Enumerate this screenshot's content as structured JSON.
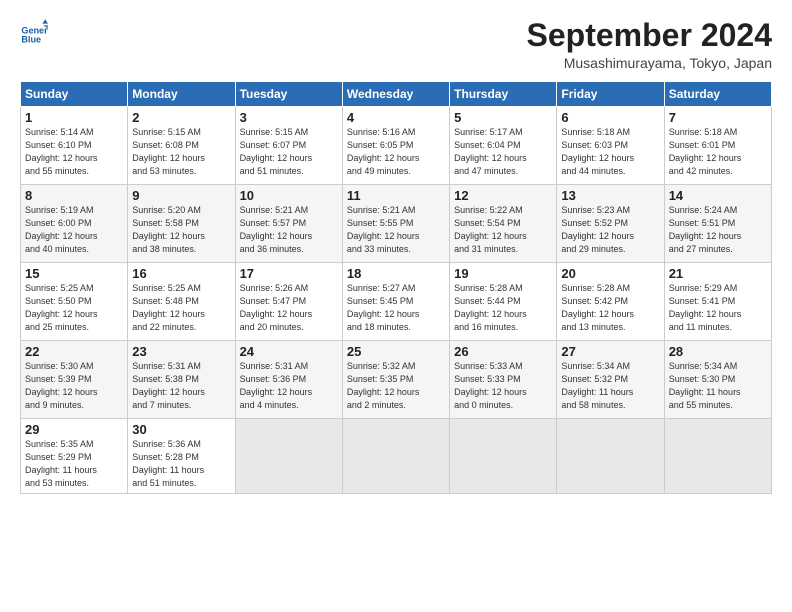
{
  "header": {
    "logo_line1": "General",
    "logo_line2": "Blue",
    "month": "September 2024",
    "location": "Musashimurayama, Tokyo, Japan"
  },
  "weekdays": [
    "Sunday",
    "Monday",
    "Tuesday",
    "Wednesday",
    "Thursday",
    "Friday",
    "Saturday"
  ],
  "weeks": [
    [
      {
        "day": "1",
        "info": "Sunrise: 5:14 AM\nSunset: 6:10 PM\nDaylight: 12 hours\nand 55 minutes."
      },
      {
        "day": "2",
        "info": "Sunrise: 5:15 AM\nSunset: 6:08 PM\nDaylight: 12 hours\nand 53 minutes."
      },
      {
        "day": "3",
        "info": "Sunrise: 5:15 AM\nSunset: 6:07 PM\nDaylight: 12 hours\nand 51 minutes."
      },
      {
        "day": "4",
        "info": "Sunrise: 5:16 AM\nSunset: 6:05 PM\nDaylight: 12 hours\nand 49 minutes."
      },
      {
        "day": "5",
        "info": "Sunrise: 5:17 AM\nSunset: 6:04 PM\nDaylight: 12 hours\nand 47 minutes."
      },
      {
        "day": "6",
        "info": "Sunrise: 5:18 AM\nSunset: 6:03 PM\nDaylight: 12 hours\nand 44 minutes."
      },
      {
        "day": "7",
        "info": "Sunrise: 5:18 AM\nSunset: 6:01 PM\nDaylight: 12 hours\nand 42 minutes."
      }
    ],
    [
      {
        "day": "8",
        "info": "Sunrise: 5:19 AM\nSunset: 6:00 PM\nDaylight: 12 hours\nand 40 minutes."
      },
      {
        "day": "9",
        "info": "Sunrise: 5:20 AM\nSunset: 5:58 PM\nDaylight: 12 hours\nand 38 minutes."
      },
      {
        "day": "10",
        "info": "Sunrise: 5:21 AM\nSunset: 5:57 PM\nDaylight: 12 hours\nand 36 minutes."
      },
      {
        "day": "11",
        "info": "Sunrise: 5:21 AM\nSunset: 5:55 PM\nDaylight: 12 hours\nand 33 minutes."
      },
      {
        "day": "12",
        "info": "Sunrise: 5:22 AM\nSunset: 5:54 PM\nDaylight: 12 hours\nand 31 minutes."
      },
      {
        "day": "13",
        "info": "Sunrise: 5:23 AM\nSunset: 5:52 PM\nDaylight: 12 hours\nand 29 minutes."
      },
      {
        "day": "14",
        "info": "Sunrise: 5:24 AM\nSunset: 5:51 PM\nDaylight: 12 hours\nand 27 minutes."
      }
    ],
    [
      {
        "day": "15",
        "info": "Sunrise: 5:25 AM\nSunset: 5:50 PM\nDaylight: 12 hours\nand 25 minutes."
      },
      {
        "day": "16",
        "info": "Sunrise: 5:25 AM\nSunset: 5:48 PM\nDaylight: 12 hours\nand 22 minutes."
      },
      {
        "day": "17",
        "info": "Sunrise: 5:26 AM\nSunset: 5:47 PM\nDaylight: 12 hours\nand 20 minutes."
      },
      {
        "day": "18",
        "info": "Sunrise: 5:27 AM\nSunset: 5:45 PM\nDaylight: 12 hours\nand 18 minutes."
      },
      {
        "day": "19",
        "info": "Sunrise: 5:28 AM\nSunset: 5:44 PM\nDaylight: 12 hours\nand 16 minutes."
      },
      {
        "day": "20",
        "info": "Sunrise: 5:28 AM\nSunset: 5:42 PM\nDaylight: 12 hours\nand 13 minutes."
      },
      {
        "day": "21",
        "info": "Sunrise: 5:29 AM\nSunset: 5:41 PM\nDaylight: 12 hours\nand 11 minutes."
      }
    ],
    [
      {
        "day": "22",
        "info": "Sunrise: 5:30 AM\nSunset: 5:39 PM\nDaylight: 12 hours\nand 9 minutes."
      },
      {
        "day": "23",
        "info": "Sunrise: 5:31 AM\nSunset: 5:38 PM\nDaylight: 12 hours\nand 7 minutes."
      },
      {
        "day": "24",
        "info": "Sunrise: 5:31 AM\nSunset: 5:36 PM\nDaylight: 12 hours\nand 4 minutes."
      },
      {
        "day": "25",
        "info": "Sunrise: 5:32 AM\nSunset: 5:35 PM\nDaylight: 12 hours\nand 2 minutes."
      },
      {
        "day": "26",
        "info": "Sunrise: 5:33 AM\nSunset: 5:33 PM\nDaylight: 12 hours\nand 0 minutes."
      },
      {
        "day": "27",
        "info": "Sunrise: 5:34 AM\nSunset: 5:32 PM\nDaylight: 11 hours\nand 58 minutes."
      },
      {
        "day": "28",
        "info": "Sunrise: 5:34 AM\nSunset: 5:30 PM\nDaylight: 11 hours\nand 55 minutes."
      }
    ],
    [
      {
        "day": "29",
        "info": "Sunrise: 5:35 AM\nSunset: 5:29 PM\nDaylight: 11 hours\nand 53 minutes."
      },
      {
        "day": "30",
        "info": "Sunrise: 5:36 AM\nSunset: 5:28 PM\nDaylight: 11 hours\nand 51 minutes."
      },
      {
        "day": "",
        "info": ""
      },
      {
        "day": "",
        "info": ""
      },
      {
        "day": "",
        "info": ""
      },
      {
        "day": "",
        "info": ""
      },
      {
        "day": "",
        "info": ""
      }
    ]
  ]
}
